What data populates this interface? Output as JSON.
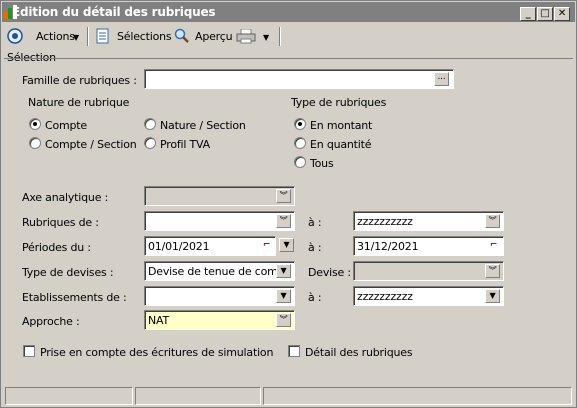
{
  "window": {
    "title": "Edition du détail des rubriques",
    "minimize_glyph": "_",
    "maximize_glyph": "□",
    "close_glyph": "✕"
  },
  "toolbar": {
    "actions_label": "Actions",
    "selections_label": "Sélections",
    "apercu_label": "Aperçu"
  },
  "section_title": "Sélection",
  "famille": {
    "label": "Famille de rubriques :",
    "value": "",
    "button_label": "..."
  },
  "nature": {
    "heading": "Nature de rubrique",
    "options": [
      "Compte",
      "Nature / Section",
      "Compte / Section",
      "Profil TVA"
    ],
    "selected": "Compte"
  },
  "type_rubriques": {
    "heading": "Type de rubriques",
    "options": [
      "En montant",
      "En quantité",
      "Tous"
    ],
    "selected": "En montant"
  },
  "axe": {
    "label": "Axe analytique :",
    "value": ""
  },
  "rubriques": {
    "label": "Rubriques de :",
    "from": "",
    "to_label": "à :",
    "to": "zzzzzzzzzz"
  },
  "periodes": {
    "label": "Périodes du :",
    "from": "01/01/2021",
    "to_label": "à :",
    "to": "31/12/2021"
  },
  "devises": {
    "label": "Type de devises :",
    "value": "Devise de tenue de compt",
    "devise_label": "Devise :",
    "devise_value": ""
  },
  "etablissements": {
    "label": "Etablissements de :",
    "from": "",
    "to_label": "à :",
    "to": "zzzzzzzzzz"
  },
  "approche": {
    "label": "Approche :",
    "value": "NAT"
  },
  "options": {
    "simulation_label": "Prise en compte des écritures de simulation",
    "simulation_checked": false,
    "detail_label": "Détail des rubriques",
    "detail_checked": false
  }
}
